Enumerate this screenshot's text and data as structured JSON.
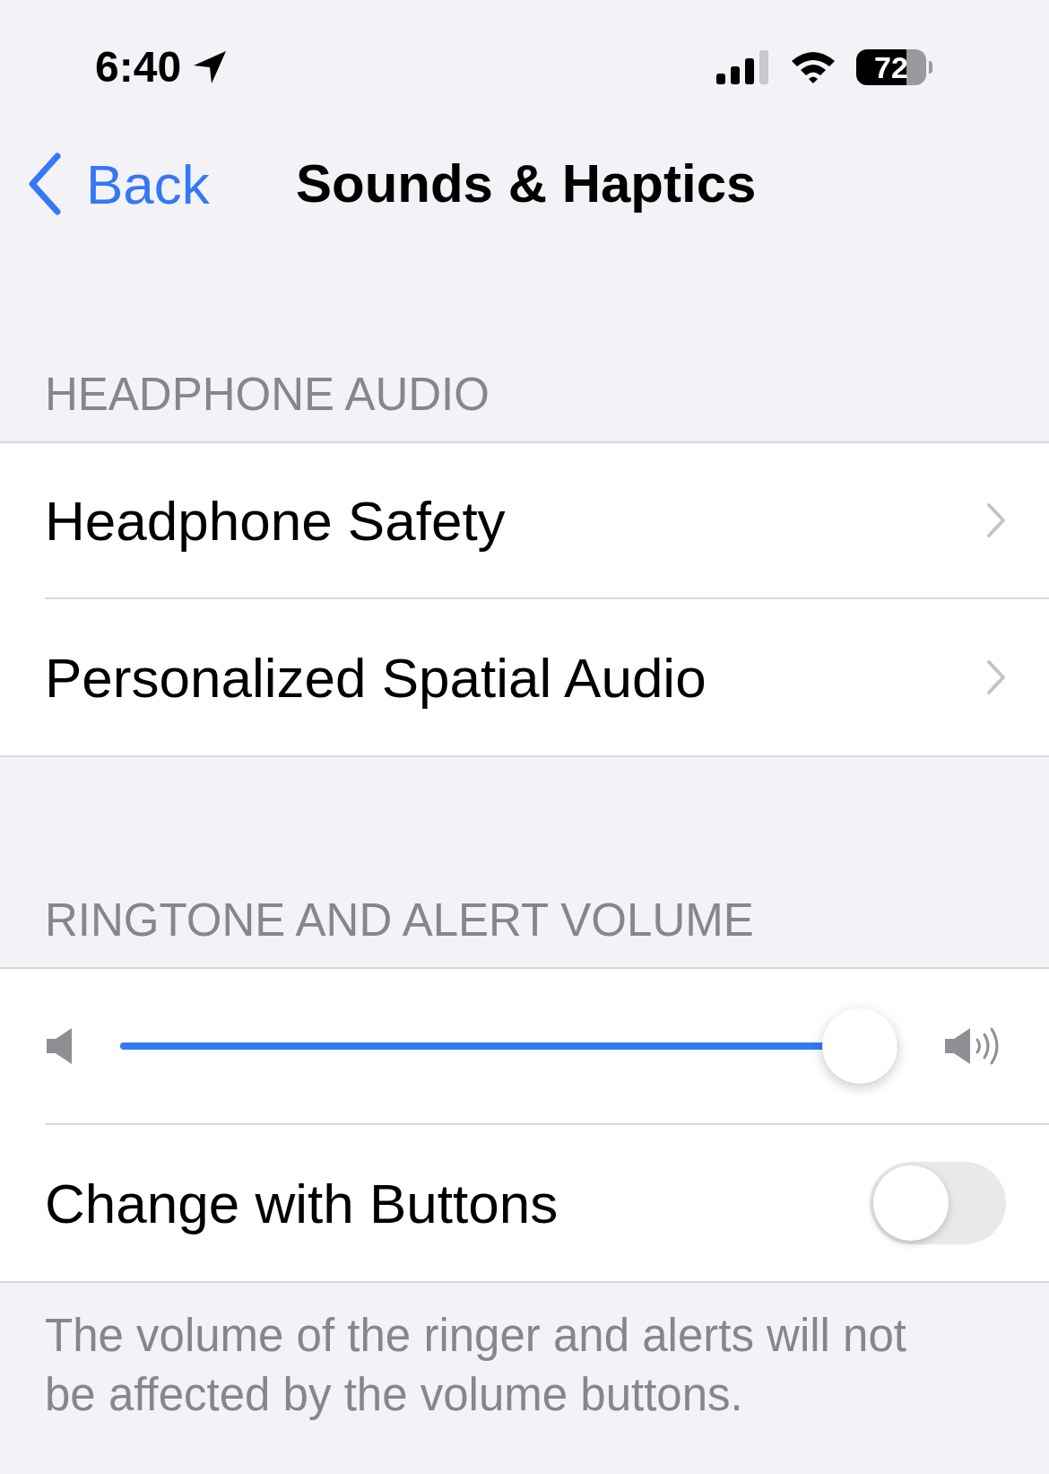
{
  "status_bar": {
    "time": "6:40",
    "battery": "72"
  },
  "nav": {
    "back": "Back",
    "title": "Sounds & Haptics"
  },
  "sections": [
    {
      "header": "HEADPHONE AUDIO",
      "rows": [
        {
          "kind": "link",
          "label": "Headphone Safety"
        },
        {
          "kind": "link",
          "label": "Personalized Spatial Audio"
        }
      ]
    },
    {
      "header": "RINGTONE AND ALERT VOLUME",
      "rows": [
        {
          "kind": "slider",
          "level": 0.95
        },
        {
          "kind": "toggle",
          "label": "Change with Buttons",
          "on": false
        }
      ],
      "footer": "The volume of the ringer and alerts will not be affected by the volume buttons."
    }
  ]
}
